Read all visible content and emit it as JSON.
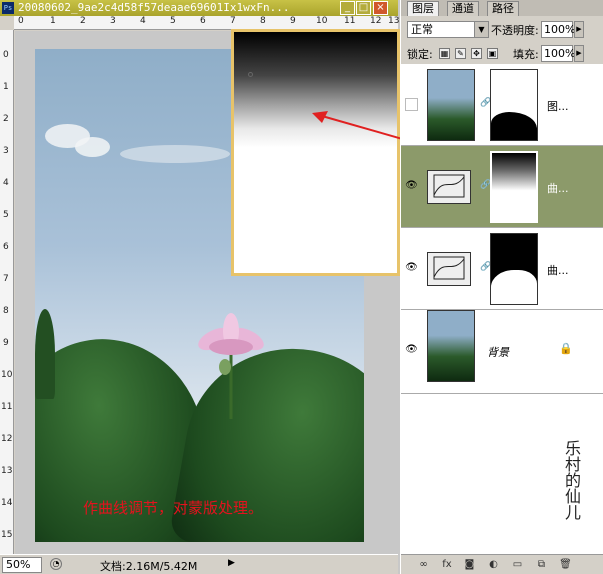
{
  "window": {
    "title": "20080602_9ae2c4d58f57deaae69601Ix1wxFn...",
    "controls": [
      "_",
      "□",
      "×"
    ]
  },
  "rulers": {
    "top_ticks": [
      "0",
      "1",
      "2",
      "3",
      "4",
      "5",
      "6",
      "7",
      "8",
      "9",
      "10",
      "11",
      "12",
      "13"
    ],
    "left_ticks": [
      "0",
      "1",
      "2",
      "3",
      "4",
      "5",
      "6",
      "7",
      "8",
      "9",
      "10",
      "11",
      "12",
      "13",
      "14",
      "15"
    ]
  },
  "canvas": {
    "caption": "作曲线调节，对蒙版处理。"
  },
  "status": {
    "zoom": "50%",
    "doc_info": "文档:2.16M/5.42M"
  },
  "panel": {
    "tabs": [
      "图层",
      "通道",
      "路径"
    ],
    "blend_mode": "正常",
    "opacity_label": "不透明度:",
    "opacity_value": "100%",
    "lock_label": "锁定:",
    "fill_label": "填充:",
    "fill_value": "100%",
    "layers": [
      {
        "name": "图...",
        "visible": false,
        "type": "image-with-mask"
      },
      {
        "name": "曲...",
        "visible": true,
        "type": "curves",
        "selected": true
      },
      {
        "name": "曲...",
        "visible": true,
        "type": "curves"
      },
      {
        "name": "背景",
        "visible": true,
        "type": "background",
        "locked": true
      }
    ],
    "seal_text": "乐村的仙儿"
  },
  "colors": {
    "selected_layer": "#8c9a6a",
    "caption_red": "#e4121e",
    "preview_border": "#e7c36a",
    "arrow": "#e02020"
  }
}
